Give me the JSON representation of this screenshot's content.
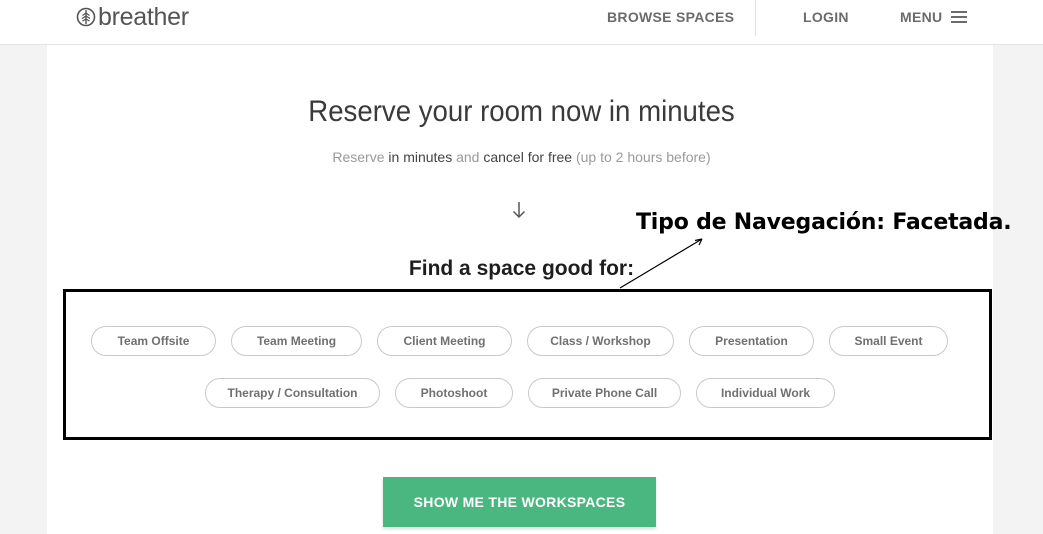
{
  "header": {
    "logo_text": "breather",
    "nav": {
      "browse": "BROWSE SPACES",
      "login": "LOGIN",
      "menu": "MENU"
    }
  },
  "hero": {
    "headline": "Reserve your room now in minutes",
    "sub": {
      "part1": "Reserve ",
      "part2": "in minutes",
      "part3": " and ",
      "part4": "cancel for free",
      "part5": " (up to 2 hours before)"
    }
  },
  "annotation": {
    "label": "Tipo de Navegación: Facetada."
  },
  "facets": {
    "title": "Find a space good for:",
    "options": [
      "Team Offsite",
      "Team Meeting",
      "Client Meeting",
      "Class / Workshop",
      "Presentation",
      "Small Event",
      "Therapy / Consultation",
      "Photoshoot",
      "Private Phone Call",
      "Individual Work"
    ]
  },
  "cta": {
    "label": "SHOW ME THE WORKSPACES"
  },
  "colors": {
    "accent": "#4ab781",
    "text_muted": "#9a9a9a",
    "chip_border": "#c9c9c9"
  },
  "icons": [
    "leaf-logo-icon",
    "hamburger-icon",
    "arrow-down-icon"
  ]
}
